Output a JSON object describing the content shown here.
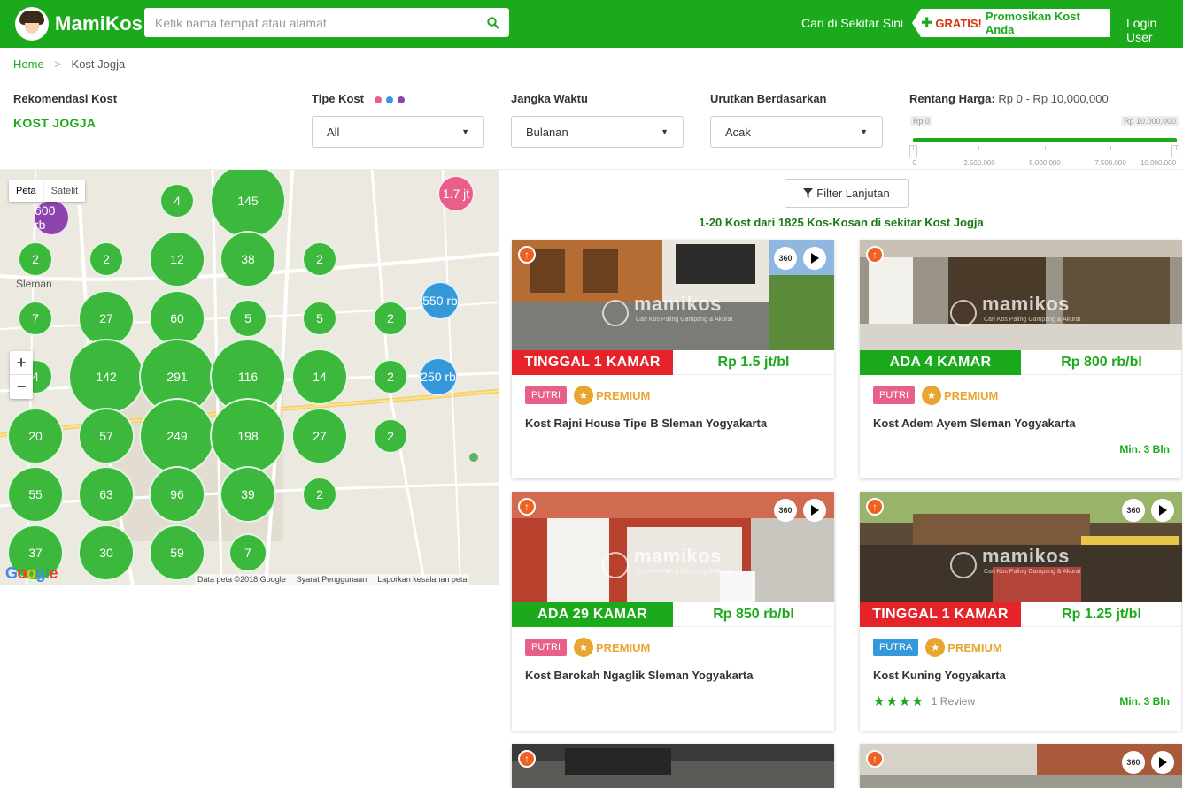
{
  "header": {
    "brand": "MamiKos",
    "search_placeholder": "Ketik nama tempat atau alamat",
    "nearby": "Cari di Sekitar Sini",
    "promo_gratis": "GRATIS!",
    "promo_rest": "Promosikan Kost Anda",
    "login": "Login User"
  },
  "breadcrumb": {
    "home": "Home",
    "current": "Kost Jogja"
  },
  "filters": {
    "reco_label": "Rekomendasi Kost",
    "reco_value": "KOST JOGJA",
    "type_label": "Tipe Kost",
    "type_value": "All",
    "term_label": "Jangka Waktu",
    "term_value": "Bulanan",
    "sort_label": "Urutkan Berdasarkan",
    "sort_value": "Acak",
    "price_label": "Rentang Harga:",
    "price_range": "Rp 0 - Rp 10,000,000",
    "price_min_tag": "Rp 0",
    "price_max_tag": "Rp 10.000.000",
    "ticks": [
      "0",
      "2.500.000",
      "5.000.000",
      "7.500.000",
      "10.000.000"
    ],
    "dot_colors": [
      "#e8608a",
      "#3498db",
      "#8e44ad"
    ]
  },
  "map": {
    "type_map": "Peta",
    "type_sat": "Satelit",
    "zoom_in": "+",
    "zoom_out": "−",
    "place_sleman": "Sleman",
    "google": "Google",
    "footer_data": "Data peta ©2018 Google",
    "footer_terms": "Syarat Penggunaan",
    "footer_report": "Laporkan kesalahan peta",
    "clusters": [
      "4",
      "145",
      "1.7 jt",
      "600 rb",
      "2",
      "2",
      "12",
      "38",
      "2",
      "550 rb",
      "7",
      "27",
      "60",
      "5",
      "5",
      "2",
      "4",
      "142",
      "291",
      "116",
      "14",
      "2",
      "250 rb",
      "20",
      "57",
      "249",
      "198",
      "27",
      "2",
      "55",
      "63",
      "96",
      "39",
      "2",
      "37",
      "30",
      "59",
      "7"
    ]
  },
  "results": {
    "filter_button": "Filter Lanjutan",
    "count_text": "1-20 Kost dari 1825 Kos-Kosan di sekitar Kost Jogja",
    "watermark": "mamikos",
    "watermark_sub": "Cari Kos Paling Gampang & Akurat",
    "label_360": "360",
    "cards": [
      {
        "availability": "TINGGAL 1 KAMAR",
        "price": "Rp 1.5 jt/bl",
        "gender": "PUTRI",
        "premium": "PREMIUM",
        "title": "Kost Rajni House Tipe B Sleman Yogyakarta",
        "min": ""
      },
      {
        "availability": "ADA 4 KAMAR",
        "price": "Rp 800 rb/bl",
        "gender": "PUTRI",
        "premium": "PREMIUM",
        "title": "Kost Adem Ayem Sleman Yogyakarta",
        "min": "Min. 3 Bln"
      },
      {
        "availability": "ADA 29 KAMAR",
        "price": "Rp 850 rb/bl",
        "gender": "PUTRI",
        "premium": "PREMIUM",
        "title": "Kost Barokah Ngaglik Sleman Yogyakarta",
        "min": ""
      },
      {
        "availability": "TINGGAL 1 KAMAR",
        "price": "Rp 1.25 jt/bl",
        "gender": "PUTRA",
        "premium": "PREMIUM",
        "title": "Kost Kuning Yogyakarta",
        "min": "Min. 3 Bln",
        "reviews": "1 Review"
      }
    ]
  },
  "colors": {
    "brand": "#1BAA1B",
    "red": "#e52329",
    "premium": "#e8a530"
  }
}
